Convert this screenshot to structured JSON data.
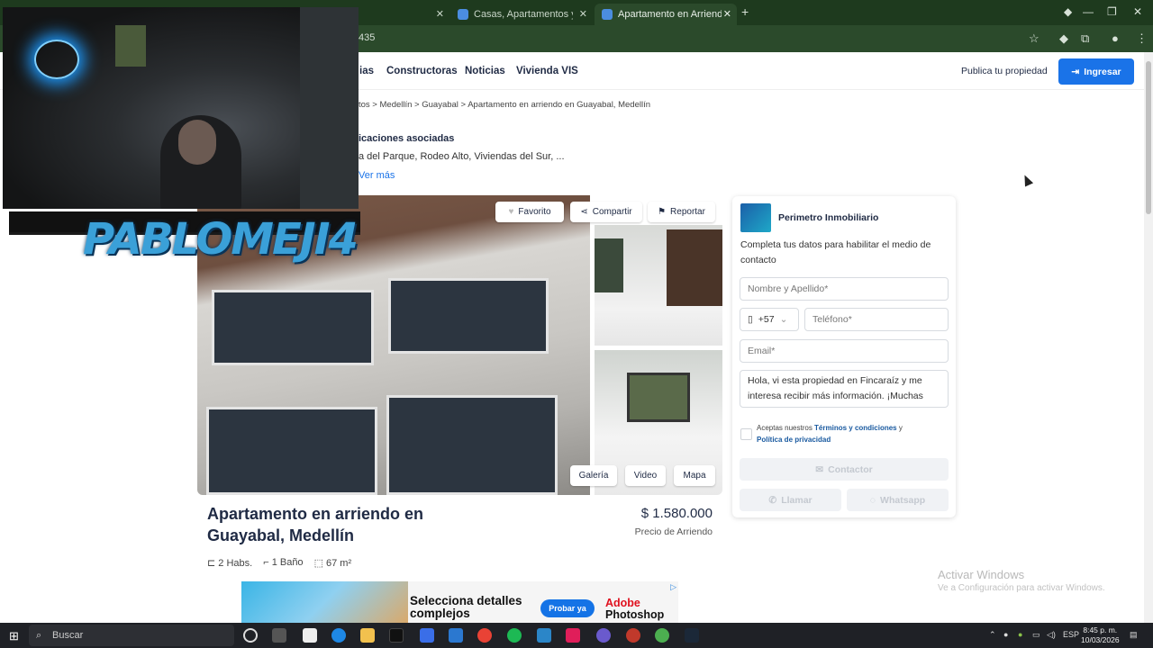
{
  "browser": {
    "tabs": [
      {
        "label": ""
      },
      {
        "label": "Casas, Apartamentos y Apartaes"
      },
      {
        "label": "Apartamento en Arriendo en M"
      }
    ],
    "new_tab": "+",
    "url_fragment": "435",
    "window_controls": {
      "minimize": "—",
      "restore": "❐",
      "close": "✕"
    }
  },
  "header": {
    "nav": [
      "ias",
      "Constructoras",
      "Noticias",
      "Vivienda VIS"
    ],
    "publish": "Publica tu propiedad",
    "login": "Ingresar"
  },
  "breadcrumb": "tos > Medellín > Guayabal > Apartamento en arriendo en Guayabal, Medellín",
  "related": {
    "title": "icaciones asociadas",
    "list": "a del Parque, Rodeo Alto, Viviendas del Sur, ...",
    "see_more": "Ver más"
  },
  "gallery": {
    "favorite": "Favorito",
    "share": "Compartir",
    "report": "Reportar",
    "gallery_btn": "Galería",
    "video_btn": "Video",
    "map_btn": "Mapa"
  },
  "contact": {
    "agency": "Perimetro Inmobiliario",
    "info": "Completa tus datos para habilitar el medio de contacto",
    "name_placeholder": "Nombre y Apellido*",
    "country_code": "+57",
    "phone_placeholder": "Teléfono*",
    "email_placeholder": "Email*",
    "message": "Hola, vi esta propiedad en Fincaraíz y me interesa recibir más información. ¡Muchas",
    "terms_prefix": "Aceptas nuestros",
    "terms_link": "Términos y condiciones",
    "terms_and": "y",
    "privacy_link": "Política de privacidad",
    "contact_btn": "Contactor",
    "call_btn": "Llamar",
    "whatsapp_btn": "Whatsapp"
  },
  "listing": {
    "title": "Apartamento en arriendo en Guayabal, Medellín",
    "price": "$ 1.580.000",
    "price_label": "Precio de Arriendo",
    "rooms": "2 Habs.",
    "baths": "1 Baño",
    "area": "67 m²"
  },
  "ad": {
    "headline": "Selecciona detalles complejos",
    "cta": "Probar ya",
    "brand_line1": "Adobe",
    "brand_line2": "Photoshop",
    "info_icon": "▷"
  },
  "watermark": {
    "line1": "Activar Windows",
    "line2": "Ve a Configuración para activar Windows."
  },
  "overlay": {
    "streamer_name": "PABLOMEJI4"
  },
  "taskbar": {
    "search": "Buscar",
    "lang": "ESP",
    "time": "8:45 p. m.",
    "date": "10/03/2026"
  },
  "colors": {
    "accent": "#1a73e8",
    "heading": "#1f2a44",
    "chrome_bg": "#1e3a1e"
  }
}
